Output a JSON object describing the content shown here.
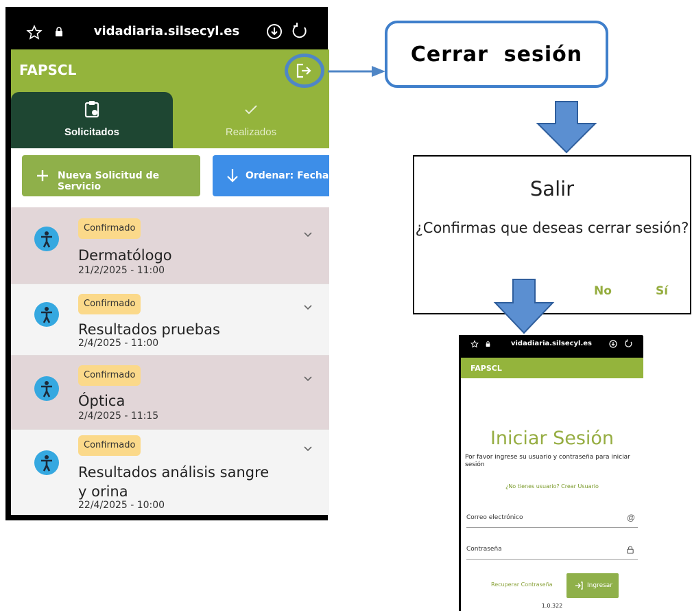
{
  "phone_main": {
    "url": "vidadiaria.silsecyl.es",
    "app_title": "FAPSCL",
    "tabs": [
      {
        "label": "Solicitados"
      },
      {
        "label": "Realizados"
      }
    ],
    "new_request_label": "Nueva Solicitud de Servicio",
    "order_label": "Ordenar: Fecha (",
    "items": [
      {
        "status": "Confirmado",
        "name": "Dermatólogo",
        "date": "21/2/2025 - 11:00"
      },
      {
        "status": "Confirmado",
        "name": "Resultados pruebas",
        "date": "2/4/2025 - 11:00"
      },
      {
        "status": "Confirmado",
        "name": "Óptica",
        "date": "2/4/2025 - 11:15"
      },
      {
        "status": "Confirmado",
        "name_line1": "Resultados análisis sangre",
        "name_line2": "y orina",
        "date": "22/4/2025 - 10:00"
      }
    ]
  },
  "callout": {
    "text": "Cerrar  sesión"
  },
  "dialog": {
    "title": "Salir",
    "message": "¿Confirmas que deseas cerrar sesión?",
    "no_label": "No",
    "yes_label": "Sí"
  },
  "phone_login": {
    "url": "vidadiaria.silsecyl.es",
    "app_title": "FAPSCL",
    "heading": "Iniciar Sesión",
    "subtitle": "Por favor ingrese su usuario y contraseña para iniciar sesión",
    "create_user_link": "¿No tienes usuario? Crear Usuario",
    "email_placeholder": "Correo electrónico",
    "password_placeholder": "Contraseña",
    "recover_label": "Recuperar Contraseña",
    "login_label": "Ingresar",
    "version": "1.0.322"
  },
  "colors": {
    "header_green": "#94b43c",
    "dark_green_tab": "#1e4632",
    "button_green": "#8fb04a",
    "button_blue": "#3d8ee8",
    "avatar_blue": "#35a8e0",
    "badge_yellow": "#fbd98a",
    "highlight_blue": "#3f7fcb",
    "row_tinted": "#e2d6d8"
  },
  "icons": [
    "star-icon",
    "lock-icon",
    "download-icon",
    "reload-icon",
    "logout-icon",
    "clipboard-icon",
    "check-icon",
    "plus-icon",
    "arrow-down-icon",
    "person-icon",
    "chevron-down-icon",
    "at-icon",
    "padlock-icon",
    "login-arrow-icon",
    "flow-arrow-icon"
  ]
}
